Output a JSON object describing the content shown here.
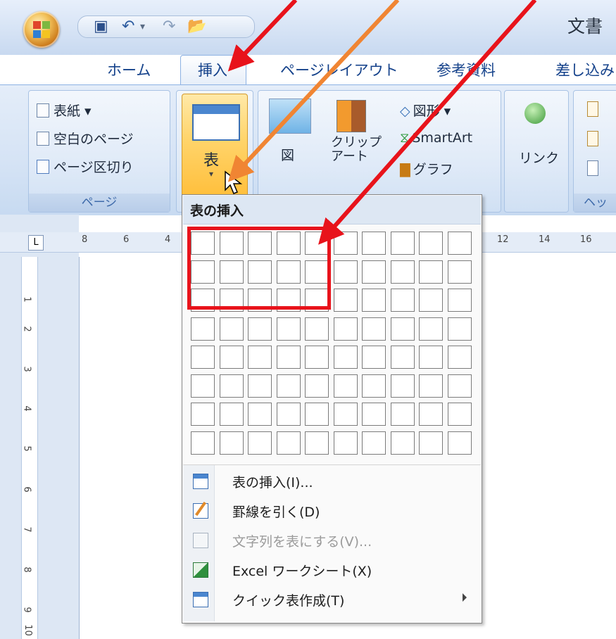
{
  "window": {
    "title": "文書"
  },
  "quick_access": {
    "icons": [
      "save-icon",
      "undo-icon",
      "redo-icon",
      "open-folder-icon"
    ]
  },
  "tabs": [
    {
      "label": "ホーム"
    },
    {
      "label": "挿入",
      "active": true
    },
    {
      "label": "ページレイアウト"
    },
    {
      "label": "参考資料"
    },
    {
      "label": "差し込み"
    }
  ],
  "ribbon": {
    "page_group": {
      "caption": "ページ",
      "items": [
        "表紙 ▾",
        "空白のページ",
        "ページ区切り"
      ]
    },
    "table_group": {
      "button_label": "表"
    },
    "illustration_group": {
      "picture_label": "図",
      "clipart_label": [
        "クリップ",
        "アート"
      ],
      "shapes_label": "図形 ▾",
      "smartart_label": "SmartArt",
      "chart_label": "グラフ"
    },
    "link_group": {
      "label": "リンク"
    },
    "header_group": {
      "caption": "ヘッ"
    }
  },
  "ruler": {
    "h_numbers": [
      "8",
      "6",
      "4",
      "12",
      "14",
      "16"
    ],
    "v_numbers": [
      "1",
      "2",
      "3",
      "4",
      "5",
      "6",
      "7",
      "8",
      "9",
      "10"
    ]
  },
  "dropdown": {
    "header": "表の挿入",
    "grid": {
      "rows": 8,
      "cols": 10,
      "highlight_rows": 3,
      "highlight_cols": 5
    },
    "menu": [
      {
        "label": "表の挿入(I)...",
        "icon": "insert-table-icon",
        "enabled": true
      },
      {
        "label": "罫線を引く(D)",
        "icon": "draw-table-icon",
        "enabled": true
      },
      {
        "label": "文字列を表にする(V)...",
        "icon": "convert-text-icon",
        "enabled": false
      },
      {
        "label": "Excel ワークシート(X)",
        "icon": "excel-icon",
        "enabled": true
      },
      {
        "label": "クイック表作成(T)",
        "icon": "quick-table-icon",
        "enabled": true,
        "submenu": true
      }
    ]
  },
  "annotation_colors": {
    "red": "#e8131b",
    "orange": "#f08533"
  }
}
